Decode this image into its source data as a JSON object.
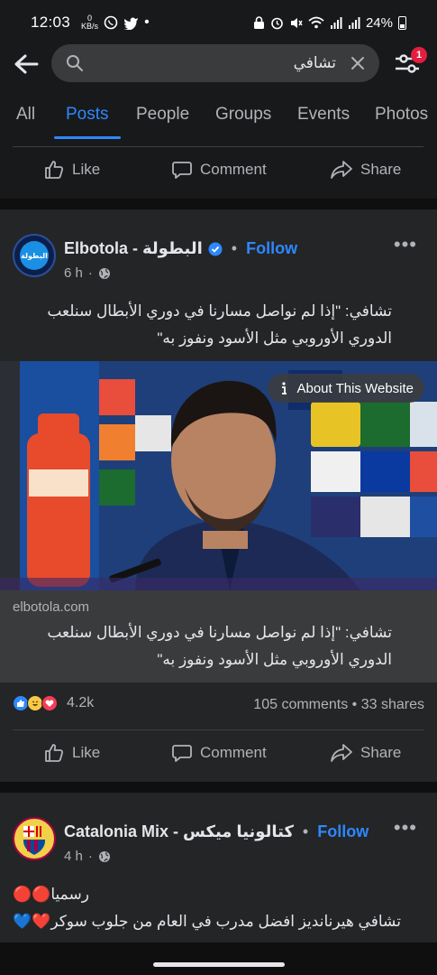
{
  "status_bar": {
    "time": "12:03",
    "kbs_top": "0",
    "kbs_bottom": "KB/s",
    "battery": "24%"
  },
  "search": {
    "query": "تشافي"
  },
  "notifications": {
    "badge": "1"
  },
  "tabs": [
    {
      "label": "All"
    },
    {
      "label": "Posts",
      "active": true
    },
    {
      "label": "People"
    },
    {
      "label": "Groups"
    },
    {
      "label": "Events"
    },
    {
      "label": "Photos"
    }
  ],
  "actions": {
    "like": "Like",
    "comment": "Comment",
    "share": "Share"
  },
  "post1": {
    "page_name": "البطولة - Elbotola",
    "avatar_text": "البطولة",
    "follow": "Follow",
    "separator": "•",
    "time": "6 h",
    "text": "تشافي: \"إذا لم نواصل مسارنا في دوري الأبطال سنلعب الدوري الأوروبي مثل الأسود ونفوز به\"",
    "about_website": "About This Website",
    "link_domain": "elbotola.com",
    "link_title": "تشافي: \"إذا لم نواصل مسارنا في دوري الأبطال سنلعب الدوري الأوروبي مثل الأسود ونفوز به\"",
    "reaction_count": "4.2k",
    "comments_shares": "105 comments • 33 shares"
  },
  "post2": {
    "page_name": "كتالونيا ميكس - Catalonia Mix",
    "follow": "Follow",
    "separator": "•",
    "time": "4 h",
    "line1": "رسميا🔴🔴",
    "line2": "تشافي هيرنانديز افضل مدرب في العام من جلوب سوكر❤️💙"
  },
  "colors": {
    "background": "#18191a",
    "card": "#242526",
    "accent": "#2d88ff",
    "text": "#e4e6eb",
    "muted": "#b0b3b8"
  }
}
